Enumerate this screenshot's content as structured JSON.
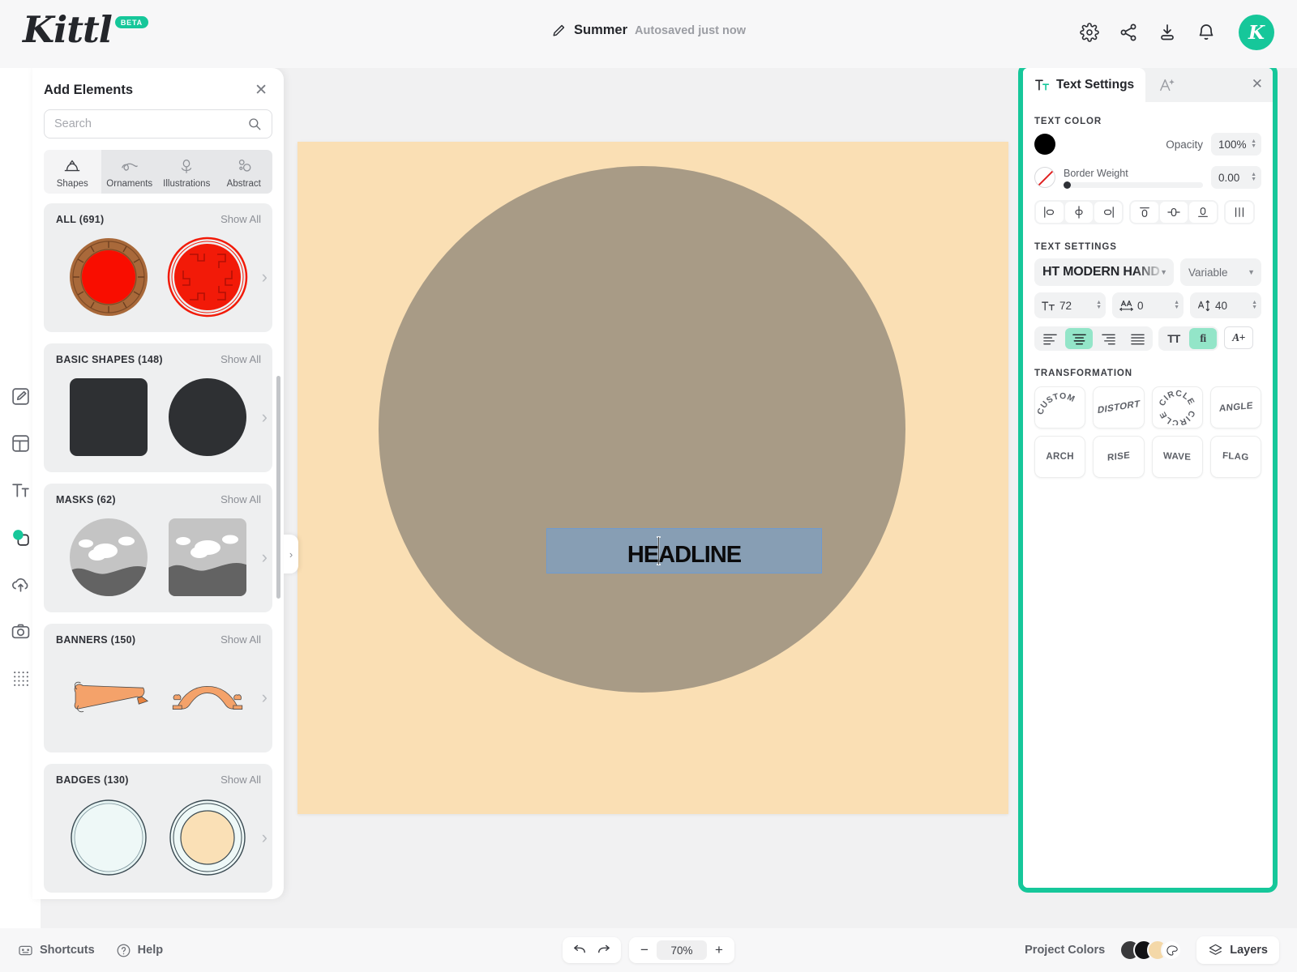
{
  "header": {
    "logo": "Kittl",
    "beta_badge": "BETA",
    "doc_title": "Summer",
    "autosave_status": "Autosaved just now",
    "pencil_icon": "pencil-icon",
    "actions": [
      {
        "name": "settings-icon",
        "label": "Settings"
      },
      {
        "name": "share-icon",
        "label": "Share"
      },
      {
        "name": "download-icon",
        "label": "Download"
      },
      {
        "name": "notifications-icon",
        "label": "Notifications"
      }
    ],
    "avatar_letter": "K",
    "accent_color": "#16c79a"
  },
  "vertical_toolbar": {
    "items": [
      {
        "name": "design-icon",
        "label": "Design"
      },
      {
        "name": "templates-icon",
        "label": "Templates"
      },
      {
        "name": "text-icon",
        "label": "Text"
      },
      {
        "name": "elements-icon",
        "label": "Elements"
      },
      {
        "name": "upload-icon",
        "label": "Uploads"
      },
      {
        "name": "photos-icon",
        "label": "Photos"
      },
      {
        "name": "grid-icon",
        "label": "Patterns"
      }
    ],
    "active_index": 3
  },
  "left_panel": {
    "title": "Add Elements",
    "close_label": "✕",
    "search": {
      "placeholder": "Search",
      "value": "",
      "icon": "search-icon"
    },
    "category_tabs": [
      {
        "label": "Shapes",
        "icon": "shapes-icon",
        "active": true
      },
      {
        "label": "Ornaments",
        "icon": "ornaments-icon",
        "active": false
      },
      {
        "label": "Illustrations",
        "icon": "illustrations-icon",
        "active": false
      },
      {
        "label": "Abstract",
        "icon": "abstract-icon",
        "active": false
      }
    ],
    "show_all_label": "Show All",
    "sections": [
      {
        "title": "ALL (691)",
        "count": 691
      },
      {
        "title": "BASIC SHAPES (148)",
        "count": 148
      },
      {
        "title": "MASKS (62)",
        "count": 62
      },
      {
        "title": "BANNERS (150)",
        "count": 150
      },
      {
        "title": "BADGES (130)",
        "count": 130
      }
    ]
  },
  "canvas": {
    "artboard_color": "#fadfb4",
    "circle_color": "#a89b86",
    "headline_text": "Headline",
    "selection_color": "#6f9bd0"
  },
  "right_panel": {
    "tab_active": "Text Settings",
    "tab_active_icon": "text-settings-icon",
    "tab_secondary_icon": "magic-text-icon",
    "close_label": "✕",
    "highlight_color": "#16c79a",
    "text_color": {
      "section_label": "TEXT COLOR",
      "swatch": "#000000",
      "opacity_label": "Opacity",
      "opacity_value": "100%",
      "border_weight_label": "Border Weight",
      "border_weight_value": "0.00"
    },
    "align_buttons": [
      {
        "name": "align-left-icon",
        "label": "Align left"
      },
      {
        "name": "align-center-horizontal-icon",
        "label": "Align center horizontally"
      },
      {
        "name": "align-right-icon",
        "label": "Align right"
      },
      {
        "name": "align-top-icon",
        "label": "Align top"
      },
      {
        "name": "align-middle-vertical-icon",
        "label": "Align middle vertically"
      },
      {
        "name": "align-bottom-icon",
        "label": "Align bottom"
      },
      {
        "name": "distribute-icon",
        "label": "Distribute"
      }
    ],
    "text_settings": {
      "section_label": "TEXT SETTINGS",
      "font_family": "HT MODERN HAND",
      "font_variant": "Variable",
      "font_size_icon": "font-size-icon",
      "font_size": "72",
      "letter_spacing_icon": "letter-spacing-icon",
      "letter_spacing": "0",
      "line_height_icon": "line-height-icon",
      "line_height": "40"
    },
    "style_buttons": [
      {
        "name": "text-align-left-icon",
        "label": "Left",
        "active": false
      },
      {
        "name": "text-align-center-icon",
        "label": "Center",
        "active": true
      },
      {
        "name": "text-align-right-icon",
        "label": "Right",
        "active": false
      },
      {
        "name": "text-align-justify-icon",
        "label": "Justify",
        "active": false
      },
      {
        "name": "uppercase-icon",
        "label": "TT",
        "active": false
      },
      {
        "name": "ligature-icon",
        "label": "fi",
        "active": true
      },
      {
        "name": "add-text-effect-icon",
        "label": "A+",
        "active": false
      }
    ],
    "transformation": {
      "section_label": "TRANSFORMATION",
      "buttons": [
        {
          "label": "CUSTOM",
          "style": "arc"
        },
        {
          "label": "DISTORT",
          "style": "skew"
        },
        {
          "label": "CIRCLE",
          "style": "circle"
        },
        {
          "label": "ANGLE",
          "style": "angle"
        },
        {
          "label": "ARCH",
          "style": "flat"
        },
        {
          "label": "RISE",
          "style": "rise"
        },
        {
          "label": "WAVE",
          "style": "wave"
        },
        {
          "label": "FLAG",
          "style": "flag"
        }
      ]
    }
  },
  "bottom_bar": {
    "shortcuts_label": "Shortcuts",
    "shortcuts_icon": "keyboard-icon",
    "help_label": "Help",
    "help_icon": "question-circle-icon",
    "undo_icon": "undo-icon",
    "redo_icon": "redo-icon",
    "zoom_out_label": "−",
    "zoom_value": "70%",
    "zoom_in_label": "+",
    "project_colors_label": "Project Colors",
    "project_colors": [
      "#3a3a3c",
      "#111114",
      "#f4d8a8"
    ],
    "color_picker_icon": "color-picker-icon",
    "layers_label": "Layers",
    "layers_icon": "layers-icon"
  }
}
